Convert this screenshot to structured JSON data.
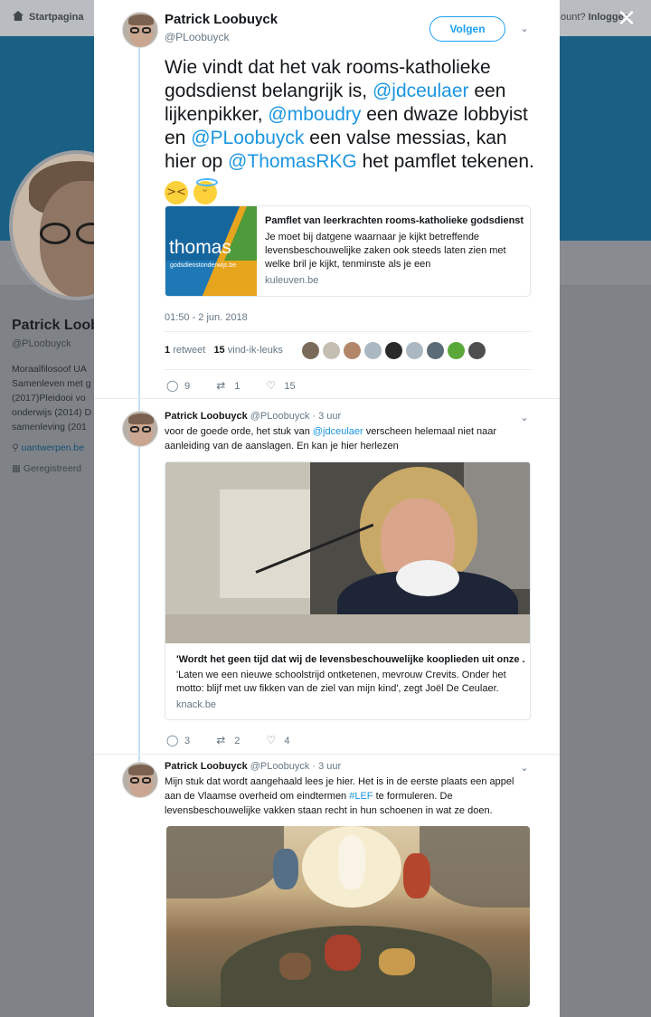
{
  "background": {
    "nav_home": "Startpagina",
    "nav_account": "ount?",
    "nav_login": "Inloggen",
    "profile_name": "Patrick Loob",
    "profile_handle": "@PLoobuyck",
    "bio_lines": [
      "Moraalfilosoof UA",
      "Samenleven met g",
      "(2017)Pleidooi vo",
      "onderwijs (2014) D",
      "samenleving (201"
    ],
    "link": "uantwerpen.be",
    "joined": "Geregistreerd"
  },
  "modal": {
    "close_icon": "close-icon",
    "main_tweet": {
      "name": "Patrick Loobuyck",
      "handle": "@PLoobuyck",
      "follow_label": "Volgen",
      "text_parts": {
        "t1": "Wie vindt dat het vak rooms-katholieke godsdienst belangrijk is, ",
        "m1": "@jdceulaer",
        "t2": " een lijkenpikker, ",
        "m2": "@mboudry",
        "t3": " een dwaze lobbyist en ",
        "m3": "@PLoobuyck",
        "t4": " een valse messias, kan hier op ",
        "m4": "@ThomasRKG",
        "t5": " het pamflet tekenen. "
      },
      "card": {
        "brand": "thomas",
        "brand_sub": "godsdienstonderwijs.be",
        "title": "Pamflet van leerkrachten rooms-katholieke godsdienst",
        "description": "Je moet bij datgene waarnaar je kijkt betreffende levensbeschouwelijke zaken ook steeds laten zien met welke bril je kijkt, tenminste als je een",
        "domain": "kuleuven.be"
      },
      "timestamp": "01:50 - 2 jun. 2018",
      "retweets_count": "1",
      "retweets_label": "retweet",
      "likes_count": "15",
      "likes_label": "vind-ik-leuks",
      "actions": {
        "replies": "9",
        "retweets": "1",
        "likes": "15"
      }
    },
    "reply1": {
      "name": "Patrick Loobuyck",
      "handle": "@PLoobuyck · 3 uur",
      "text_a": "voor de goede orde, het stuk van ",
      "mention": "@jdceulaer",
      "text_b": " verscheen helemaal niet naar aanleiding van de aanslagen. En kan je hier herlezen",
      "card": {
        "title": "'Wordt het geen tijd dat wij de levensbeschouwelijke kooplieden uit onze ...",
        "description": "'Laten we een nieuwe schoolstrijd ontketenen, mevrouw Crevits. Onder het motto: blijf met uw fikken van de ziel van mijn kind', zegt Joël De Ceulaer.",
        "domain": "knack.be"
      },
      "actions": {
        "replies": "3",
        "retweets": "2",
        "likes": "4"
      }
    },
    "reply2": {
      "name": "Patrick Loobuyck",
      "handle": "@PLoobuyck · 3 uur",
      "text_a": "Mijn stuk dat wordt aangehaald lees je hier. Het is in de eerste plaats een appel aan de Vlaamse overheid om eindtermen ",
      "hashtag": "#LEF",
      "text_b": " te formuleren. De levensbeschouwelijke vakken staan recht in hun schoenen in wat ze doen."
    }
  },
  "colors": {
    "accent": "#1da1f2",
    "mention": "#1b95e0",
    "muted": "#657786"
  }
}
